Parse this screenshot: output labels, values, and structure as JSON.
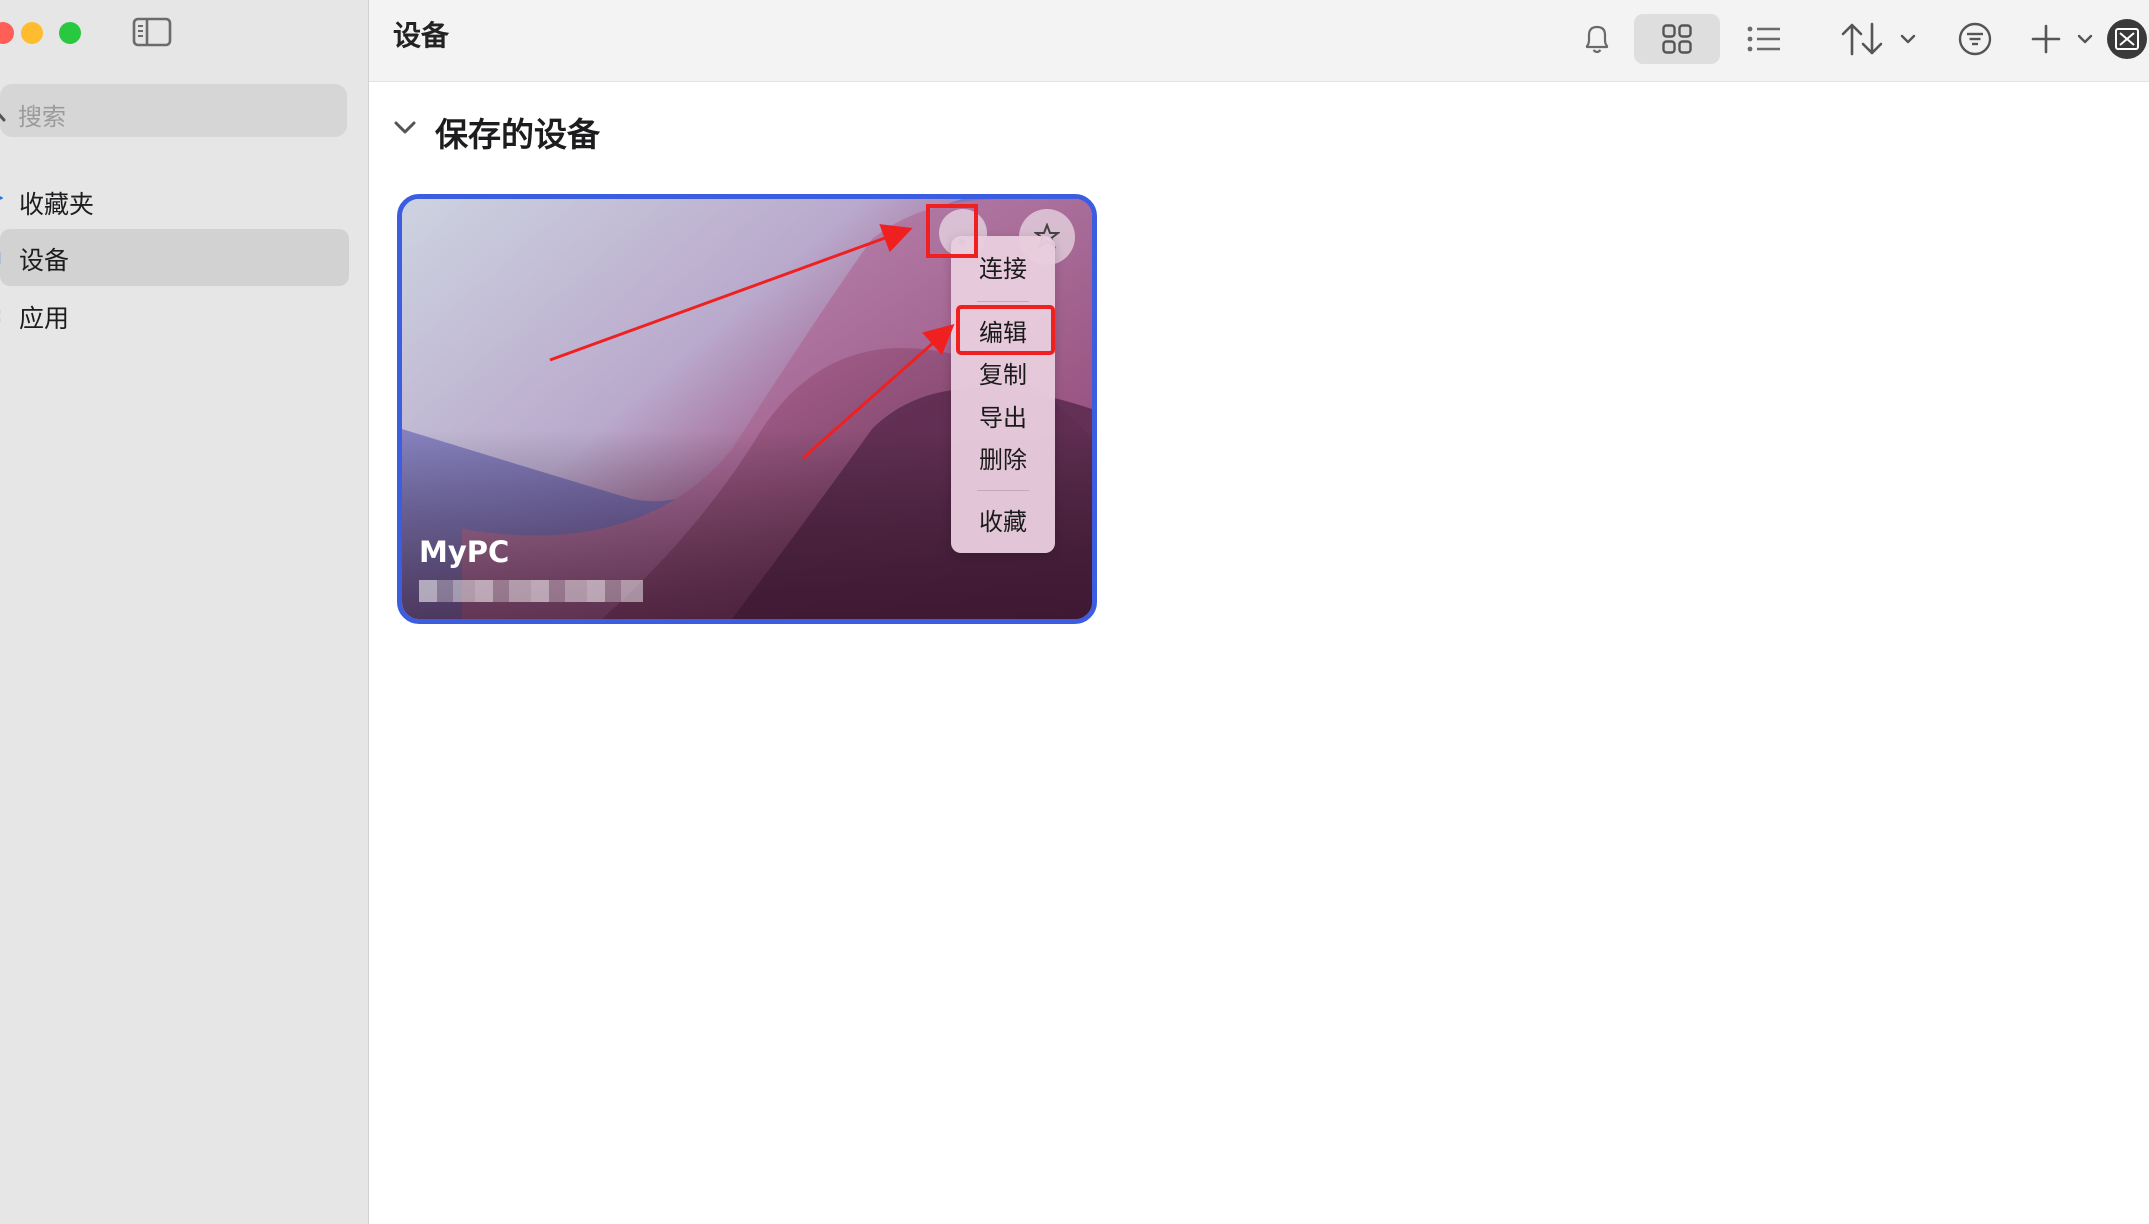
{
  "sidebar": {
    "search": {
      "placeholder": "搜索"
    },
    "items": [
      {
        "label": "收藏夹",
        "icon": "star-icon",
        "active": false
      },
      {
        "label": "设备",
        "icon": "monitor-icon",
        "active": true
      },
      {
        "label": "应用",
        "icon": "apps-icon",
        "active": false
      }
    ]
  },
  "toolbar": {
    "title": "设备",
    "buttons": [
      {
        "icon": "bell-icon"
      },
      {
        "icon": "grid-view-icon",
        "selected": true
      },
      {
        "icon": "list-view-icon"
      },
      {
        "icon": "sort-icon"
      },
      {
        "icon": "filter-icon"
      },
      {
        "icon": "plus-icon"
      },
      {
        "icon": "remote-desktop-icon"
      }
    ]
  },
  "main": {
    "section_title": "保存的设备",
    "device": {
      "name": "MyPC",
      "address_redacted": true
    },
    "context_menu": {
      "items": [
        "连接",
        "编辑",
        "复制",
        "导出",
        "删除",
        "收藏"
      ]
    }
  },
  "colors": {
    "card_border": "#3d5de0",
    "annotation": "#f02020",
    "sidebar_bg": "#e6e6e6",
    "toolbar_bg": "#f3f3f3"
  }
}
